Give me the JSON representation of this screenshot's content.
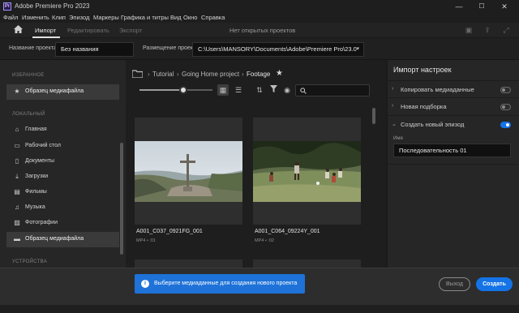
{
  "window": {
    "logo_text": "Pr",
    "title": "Adobe Premiere Pro 2023",
    "controls": [
      "—",
      "☐",
      "✕"
    ]
  },
  "menu": [
    "Файл",
    "Изменить",
    "Клип",
    "Эпизод",
    "Маркеры",
    "Графика и титры",
    "Вид",
    "Окно",
    "Справка"
  ],
  "header": {
    "tabs": [
      {
        "label": "Импорт",
        "active": true
      },
      {
        "label": "Редактировать",
        "active": false
      },
      {
        "label": "Экспорт",
        "active": false
      }
    ],
    "status": "Нет открытых проектов"
  },
  "project": {
    "name_label": "Название проекта",
    "name_value": "Без названия",
    "location_label": "Размещение проекта",
    "location_value": "C:\\Users\\MANSORY\\Documents\\Adobe\\Premiere Pro\\23.0"
  },
  "sidebar": {
    "recent_header": "ИЗБРАННОЕ",
    "favorite_item": "Образец медиафайла",
    "local_header": "ЛОКАЛЬНЫЙ",
    "local_items": [
      {
        "label": "Главная",
        "icon": "home-icon"
      },
      {
        "label": "Рабочий стол",
        "icon": "desktop-icon"
      },
      {
        "label": "Документы",
        "icon": "document-icon"
      },
      {
        "label": "Загрузки",
        "icon": "download-icon"
      },
      {
        "label": "Фильмы",
        "icon": "film-icon"
      },
      {
        "label": "Музыка",
        "icon": "music-icon"
      },
      {
        "label": "Фотографии",
        "icon": "photo-icon"
      },
      {
        "label": "Образец медиафайла",
        "icon": "folder-icon",
        "selected": true
      }
    ],
    "devices_header": "УСТРОЙСТВА"
  },
  "browser": {
    "breadcrumb": [
      "Tutorial",
      "Going Home project",
      "Footage"
    ],
    "zoom_fraction": 0.6,
    "items": [
      {
        "name": "A001_C037_0921FG_001",
        "meta": "MP4 • :01"
      },
      {
        "name": "A001_C064_09224Y_001",
        "meta": "MP4 • :02"
      }
    ]
  },
  "import_settings": {
    "title": "Импорт настроек",
    "options": [
      {
        "label": "Копировать медиаданные",
        "on": false
      },
      {
        "label": "Новая подборка",
        "on": false
      },
      {
        "label": "Создать новый эпизод",
        "on": true
      }
    ],
    "name_label": "Имя",
    "name_value": "Последовательность 01"
  },
  "footer": {
    "message": "Выберите медиаданные для создания нового проекта",
    "exit_label": "Выход",
    "create_label": "Создать"
  },
  "colors": {
    "accent": "#1473e6",
    "banner": "#1e72d8"
  }
}
